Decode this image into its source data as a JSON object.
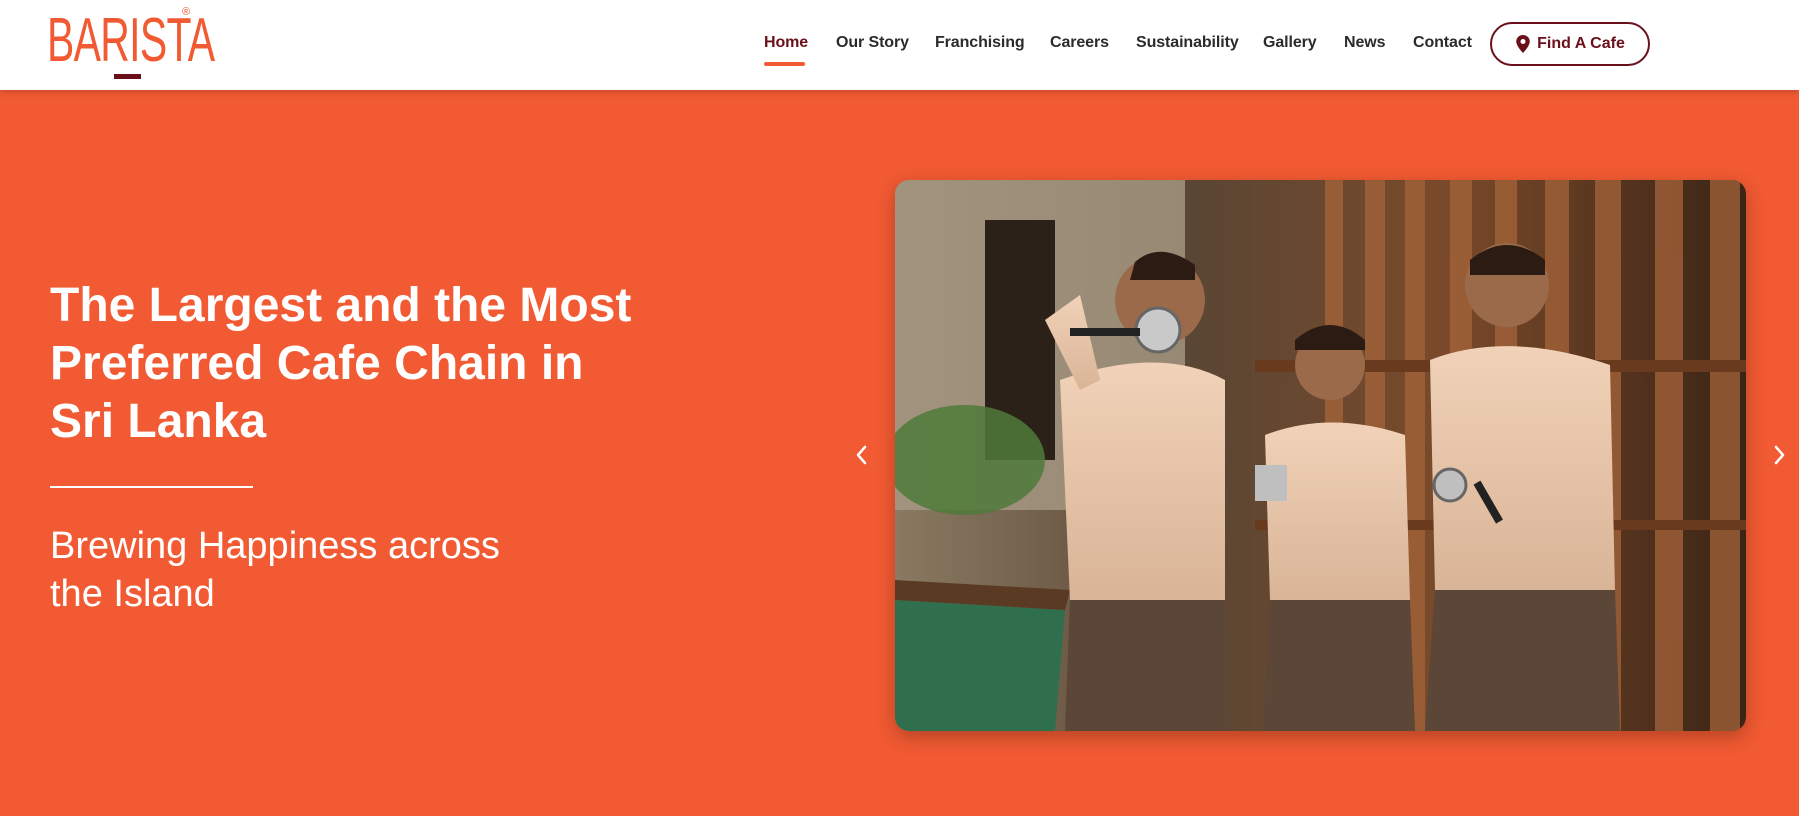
{
  "brand": {
    "name": "BARISTA",
    "reg_mark": "®",
    "accent": "#f15a32",
    "maroon": "#6b0f1a"
  },
  "nav": {
    "items": [
      {
        "label": "Home",
        "active": true
      },
      {
        "label": "Our Story"
      },
      {
        "label": "Franchising"
      },
      {
        "label": "Careers"
      },
      {
        "label": "Sustainability"
      },
      {
        "label": "Gallery"
      },
      {
        "label": "News"
      },
      {
        "label": "Contact"
      }
    ],
    "cta": {
      "label": "Find A Cafe",
      "icon": "map-pin-icon"
    }
  },
  "hero": {
    "title_lines": [
      "The Largest and the Most",
      "Preferred Cafe Chain in",
      "Sri Lanka"
    ],
    "subtitle_lines": [
      "Brewing Happiness across",
      "the Island"
    ],
    "prev_icon": "chevron-left-icon",
    "next_icon": "chevron-right-icon",
    "photo_alt": "Three baristas in uniform smiling in a cafe"
  }
}
